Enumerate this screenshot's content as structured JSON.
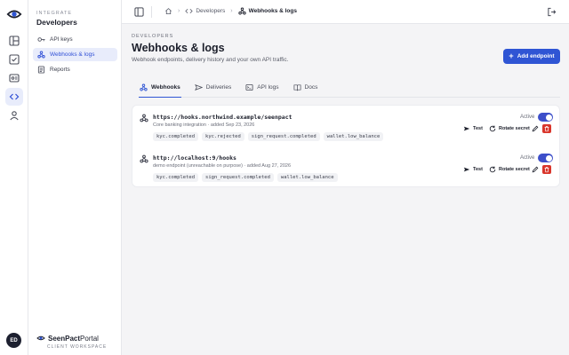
{
  "rail": {
    "items": [
      {
        "name": "dashboard-icon",
        "active": false
      },
      {
        "name": "document-check-icon",
        "active": false
      },
      {
        "name": "id-card-icon",
        "active": false
      },
      {
        "name": "code-icon",
        "active": true
      },
      {
        "name": "user-icon",
        "active": false
      }
    ],
    "avatar_initials": "ED"
  },
  "subnav": {
    "eyebrow": "INTEGRATE",
    "title": "Developers",
    "items": [
      {
        "label": "API keys",
        "icon": "key-icon",
        "active": false
      },
      {
        "label": "Webhooks & logs",
        "icon": "webhook-icon",
        "active": true
      },
      {
        "label": "Reports",
        "icon": "report-icon",
        "active": false
      }
    ],
    "brand_bold": "SeenPact",
    "brand_rest": " Portal",
    "brand_sub": "CLIENT WORKSPACE"
  },
  "topbar": {
    "crumbs": [
      "Developers",
      "Webhooks & logs"
    ]
  },
  "header": {
    "eyebrow": "DEVELOPERS",
    "title": "Webhooks & logs",
    "subtitle": "Webhook endpoints, delivery history and your own API traffic.",
    "add_label": "Add endpoint"
  },
  "tabs": [
    {
      "label": "Webhooks",
      "icon": "webhook-icon",
      "active": true
    },
    {
      "label": "Deliveries",
      "icon": "send-icon",
      "active": false
    },
    {
      "label": "API logs",
      "icon": "terminal-icon",
      "active": false
    },
    {
      "label": "Docs",
      "icon": "book-icon",
      "active": false
    }
  ],
  "webhooks": [
    {
      "url": "https://hooks.northwind.example/seenpact",
      "meta": "Core banking integration · added Sep 23, 2026",
      "events": [
        "kyc.completed",
        "kyc.rejected",
        "sign_request.completed",
        "wallet.low_balance"
      ],
      "status": "Active",
      "test_label": "Test",
      "rotate_label": "Rotate secret"
    },
    {
      "url": "http://localhost:9/hooks",
      "meta": "demo endpoint (unreachable on purpose) · added Aug 27, 2026",
      "events": [
        "kyc.completed",
        "sign_request.completed",
        "wallet.low_balance"
      ],
      "status": "Active",
      "test_label": "Test",
      "rotate_label": "Rotate secret"
    }
  ],
  "colors": {
    "accent": "#2f55d4",
    "toggle_on": "#3d4fc9",
    "danger": "#d9352b",
    "active_nav_bg": "#e8ecfb"
  }
}
